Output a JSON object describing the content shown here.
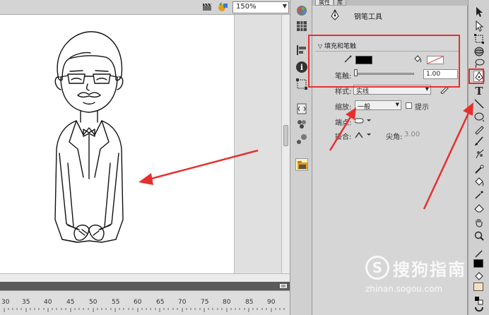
{
  "stage": {
    "zoom": "150%"
  },
  "timeline": {
    "ruler": [
      "30",
      "35",
      "40",
      "45",
      "50",
      "55",
      "60",
      "65",
      "70",
      "75",
      "80",
      "85",
      "90"
    ]
  },
  "properties": {
    "tabs": [
      "属性",
      "库"
    ],
    "tool_name": "钢笔工具",
    "fill_section_title": "填充和笔触",
    "stroke_label": "笔触:",
    "stroke_value": "1.00",
    "style_label": "样式:",
    "style_value": "实线",
    "scale_label": "缩放:",
    "scale_value": "一般",
    "hint_label": "提示",
    "cap_label": "端点:",
    "join_label": "接合:",
    "miter_label": "尖角:",
    "miter_value": "3.00",
    "stroke_color": "#000000",
    "fill_color": "none"
  },
  "watermark": {
    "title": "搜狗指南",
    "url": "zhinan.sogou.com"
  },
  "colors": {
    "annotation": "#e53030"
  }
}
